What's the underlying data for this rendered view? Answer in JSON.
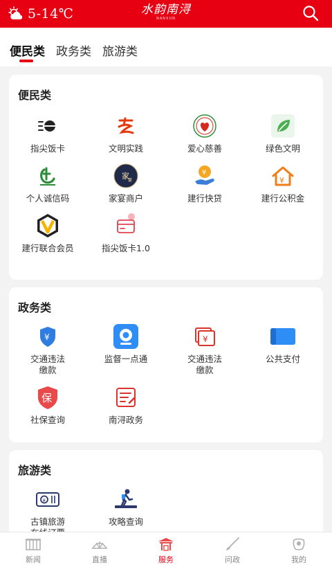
{
  "header": {
    "weather_text": "5-14℃",
    "weather_icon": "partly-cloudy-icon",
    "brand_text": "水韵南浔",
    "brand_sub": "NANXUN",
    "search_icon": "search-icon",
    "bg_color": "#e60012"
  },
  "tabs": [
    {
      "label": "便民类",
      "active": true
    },
    {
      "label": "政务类",
      "active": false
    },
    {
      "label": "旅游类",
      "active": false
    }
  ],
  "sections": {
    "bianmin": {
      "title": "便民类",
      "items": [
        {
          "label": "指尖饭卡",
          "icon": "meal-card-icon"
        },
        {
          "label": "文明实践",
          "icon": "civilization-practice-icon"
        },
        {
          "label": "爱心慈善",
          "icon": "charity-icon"
        },
        {
          "label": "绿色文明",
          "icon": "green-leaf-icon"
        },
        {
          "label": "个人诚信码",
          "icon": "credit-code-icon"
        },
        {
          "label": "家宴商户",
          "icon": "family-banquet-icon"
        },
        {
          "label": "建行快贷",
          "icon": "ccb-loan-icon"
        },
        {
          "label": "建行公积金",
          "icon": "housing-fund-icon"
        },
        {
          "label": "建行联合会员",
          "icon": "ccb-v-icon"
        },
        {
          "label": "指尖饭卡1.0",
          "icon": "card-icon"
        }
      ]
    },
    "zhengwu": {
      "title": "政务类",
      "items": [
        {
          "label": "交通违法缴款",
          "icon": "shield-yuan-icon"
        },
        {
          "label": "监督一点通",
          "icon": "camera-icon"
        },
        {
          "label": "交通违法缴款",
          "icon": "bill-yuan-icon"
        },
        {
          "label": "公共支付",
          "icon": "payment-card-icon"
        },
        {
          "label": "社保查询",
          "icon": "social-security-icon"
        },
        {
          "label": "南浔政务",
          "icon": "document-icon"
        }
      ]
    },
    "lvyou": {
      "title": "旅游类",
      "items": [
        {
          "label": "古镇旅游在线订票",
          "icon": "ticket-icon"
        },
        {
          "label": "攻略查询",
          "icon": "hiker-icon"
        }
      ]
    }
  },
  "bottom_nav": [
    {
      "label": "新闻",
      "icon": "news-icon",
      "active": false
    },
    {
      "label": "直播",
      "icon": "live-icon",
      "active": false
    },
    {
      "label": "服务",
      "icon": "service-icon",
      "active": true
    },
    {
      "label": "问政",
      "icon": "brush-icon",
      "active": false
    },
    {
      "label": "我的",
      "icon": "profile-icon",
      "active": false
    }
  ]
}
